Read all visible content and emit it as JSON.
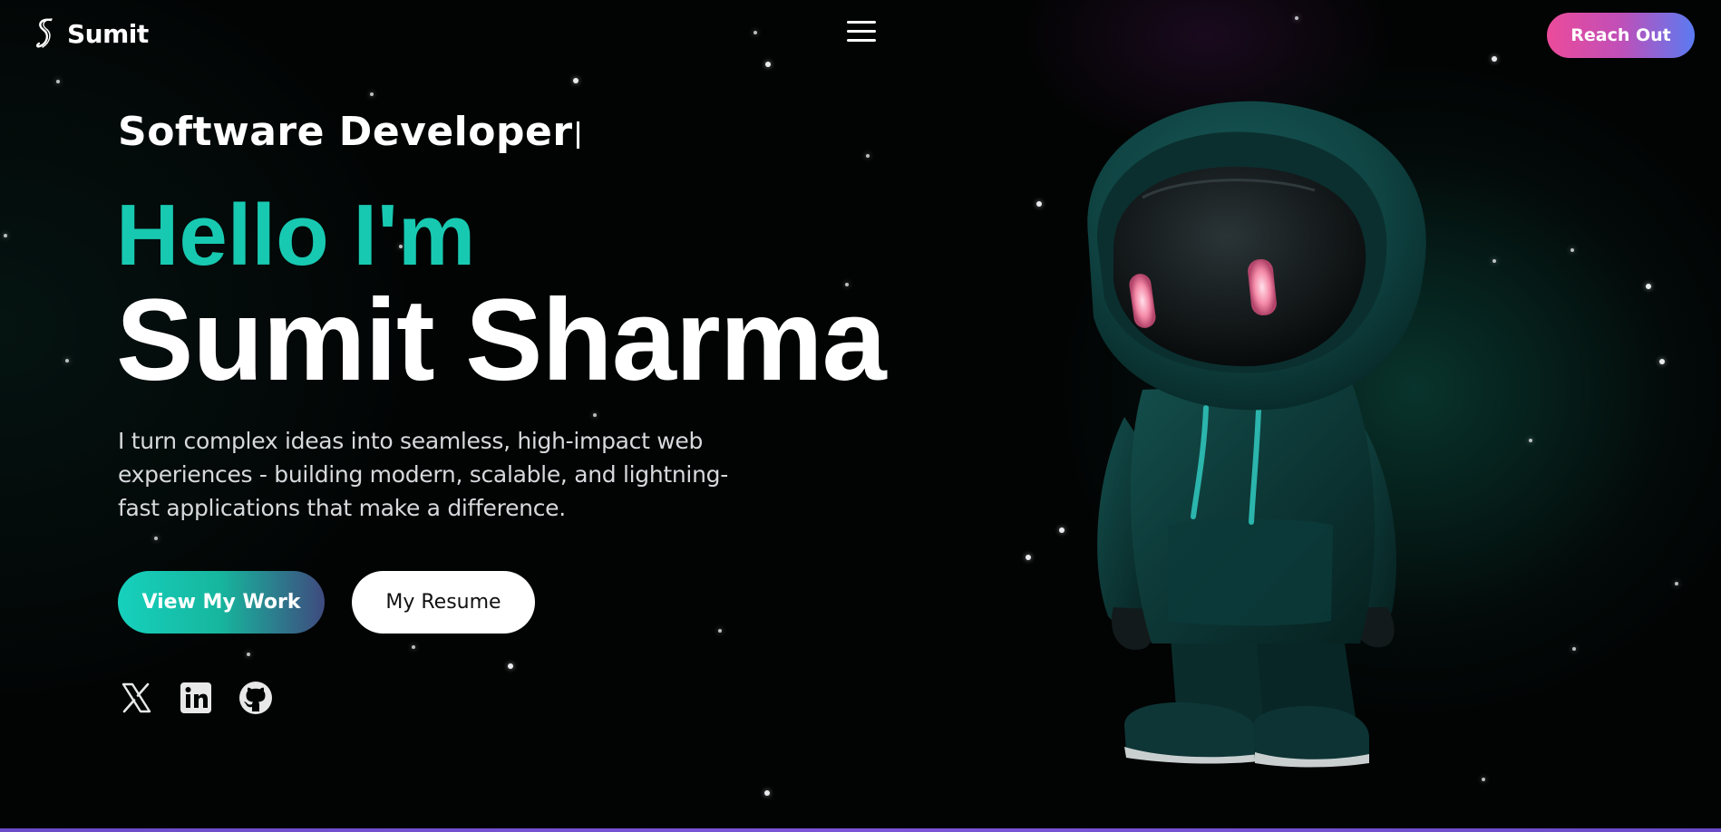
{
  "header": {
    "logo_text": "Sumit",
    "logo_icon": "s-logo-icon",
    "menu_icon": "hamburger-menu-icon",
    "reach_out_label": "Reach Out"
  },
  "hero": {
    "role": "Software Developer",
    "greeting": "Hello I'm",
    "name": "Sumit Sharma",
    "description": "I turn complex ideas into seamless, high-impact web experiences - building modern, scalable, and lightning-fast applications that make a difference.",
    "primary_button": "View My Work",
    "secondary_button": "My Resume"
  },
  "socials": [
    {
      "icon": "x-twitter-icon"
    },
    {
      "icon": "linkedin-icon"
    },
    {
      "icon": "github-icon"
    }
  ],
  "colors": {
    "background": "#020303",
    "accent_teal": "#18c9b1",
    "reach_out_gradient_start": "#ec4b9a",
    "reach_out_gradient_end": "#5a7bf2",
    "bottom_border": "#6a4bc8"
  },
  "illustration": "hooded-robot-character"
}
